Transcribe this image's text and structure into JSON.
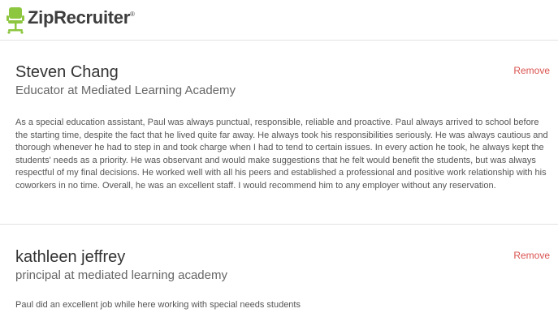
{
  "header": {
    "logo_text": "ZipRecruiter",
    "logo_mark": "®",
    "logo_icon": "chair-icon",
    "brand_color": "#8dc63f"
  },
  "recommendations": [
    {
      "name": "Steven Chang",
      "title": "Educator at Mediated Learning Academy",
      "remove_label": "Remove",
      "text": "As a special education assistant, Paul was always punctual, responsible, reliable and proactive. Paul always arrived to school before the starting time, despite the fact that he lived quite far away. He always took his responsibilities seriously. He was always cautious and thorough whenever he had to step in and took charge when I had to tend to certain issues. In every action he took, he always kept the students' needs as a priority. He was observant and would make suggestions that he felt would benefit the students, but was always respectful of my final decisions. He worked well with all his peers and established a professional and positive work relationship with his coworkers in no time. Overall, he was an excellent staff. I would recommend him to any employer without any reservation."
    },
    {
      "name": "kathleen jeffrey",
      "title": "principal at mediated learning academy",
      "remove_label": "Remove",
      "text": "Paul did an excellent job while here working with special needs students"
    }
  ],
  "colors": {
    "remove": "#d9534f",
    "divider": "#e2e2e2"
  }
}
